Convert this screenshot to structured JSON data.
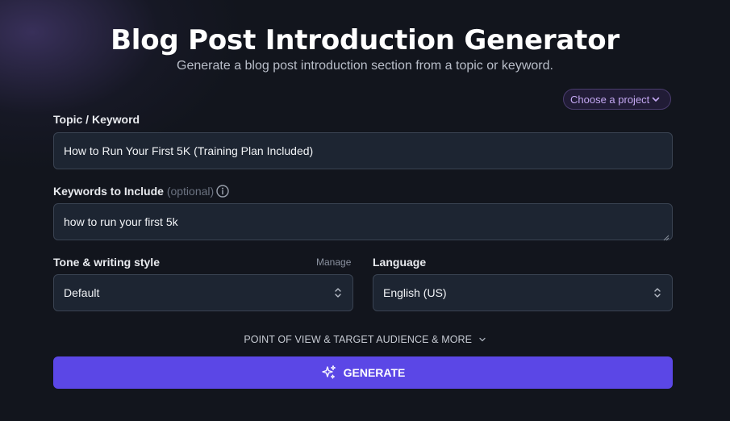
{
  "header": {
    "title": "Blog Post Introduction Generator",
    "subtitle": "Generate a blog post introduction section from a topic or keyword."
  },
  "project_selector": {
    "label": "Choose a project",
    "icon": "chevron-down-icon"
  },
  "topic": {
    "label": "Topic / Keyword",
    "value": "How to Run Your First 5K (Training Plan Included)"
  },
  "keywords": {
    "label": "Keywords to Include",
    "optional_label": "(optional)",
    "info_icon": "info-icon",
    "value": "how to run your first 5k"
  },
  "tone": {
    "label": "Tone & writing style",
    "manage_label": "Manage",
    "selected": "Default"
  },
  "language": {
    "label": "Language",
    "selected": "English (US)"
  },
  "more_options": {
    "label": "POINT OF VIEW & TARGET AUDIENCE & MORE"
  },
  "generate_button": {
    "label": "GENERATE",
    "icon": "sparkles-icon"
  },
  "colors": {
    "accent": "#5b47e6",
    "project_text": "#c4a8f2",
    "field_bg": "#1d2532",
    "page_bg": "#12151d"
  }
}
